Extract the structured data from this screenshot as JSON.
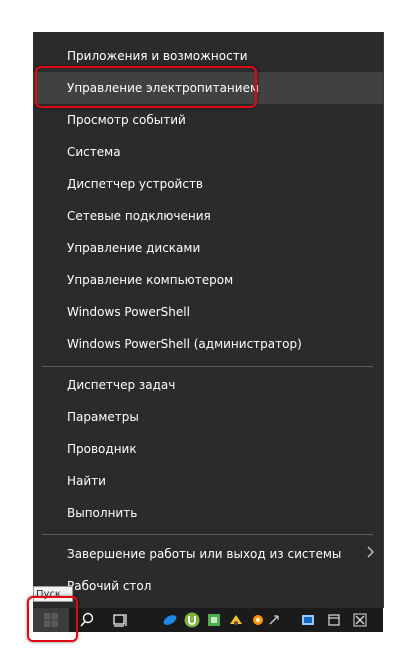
{
  "menu": {
    "items_group1": [
      {
        "label": "Приложения и возможности"
      },
      {
        "label": "Управление электропитанием"
      },
      {
        "label": "Просмотр событий"
      },
      {
        "label": "Система"
      },
      {
        "label": "Диспетчер устройств"
      },
      {
        "label": "Сетевые подключения"
      },
      {
        "label": "Управление дисками"
      },
      {
        "label": "Управление компьютером"
      },
      {
        "label": "Windows PowerShell"
      },
      {
        "label": "Windows PowerShell (администратор)"
      }
    ],
    "items_group2": [
      {
        "label": "Диспетчер задач"
      },
      {
        "label": "Параметры"
      },
      {
        "label": "Проводник"
      },
      {
        "label": "Найти"
      },
      {
        "label": "Выполнить"
      }
    ],
    "items_group3": [
      {
        "label": "Завершение работы или выход из системы",
        "submenu_icon": "chevron-right-icon"
      },
      {
        "label": "Рабочий стол"
      }
    ]
  },
  "tooltip": {
    "text": "Пуск"
  },
  "taskbar": {
    "icons": [
      "windows-logo-icon",
      "search-icon",
      "task-view-icon",
      "app-icon-blue",
      "utorrent-icon",
      "app-icon-green",
      "app-icon-yellow",
      "app-icon-orange",
      "app-icon-grey",
      "app-icon-blue2",
      "app-icon-grey2",
      "app-icon-grey3"
    ]
  },
  "colors": {
    "menu_bg": "#2b2b2b",
    "hover_bg": "#414141",
    "highlight_red": "#e30613",
    "taskbar_bg": "#1b1b1b"
  }
}
